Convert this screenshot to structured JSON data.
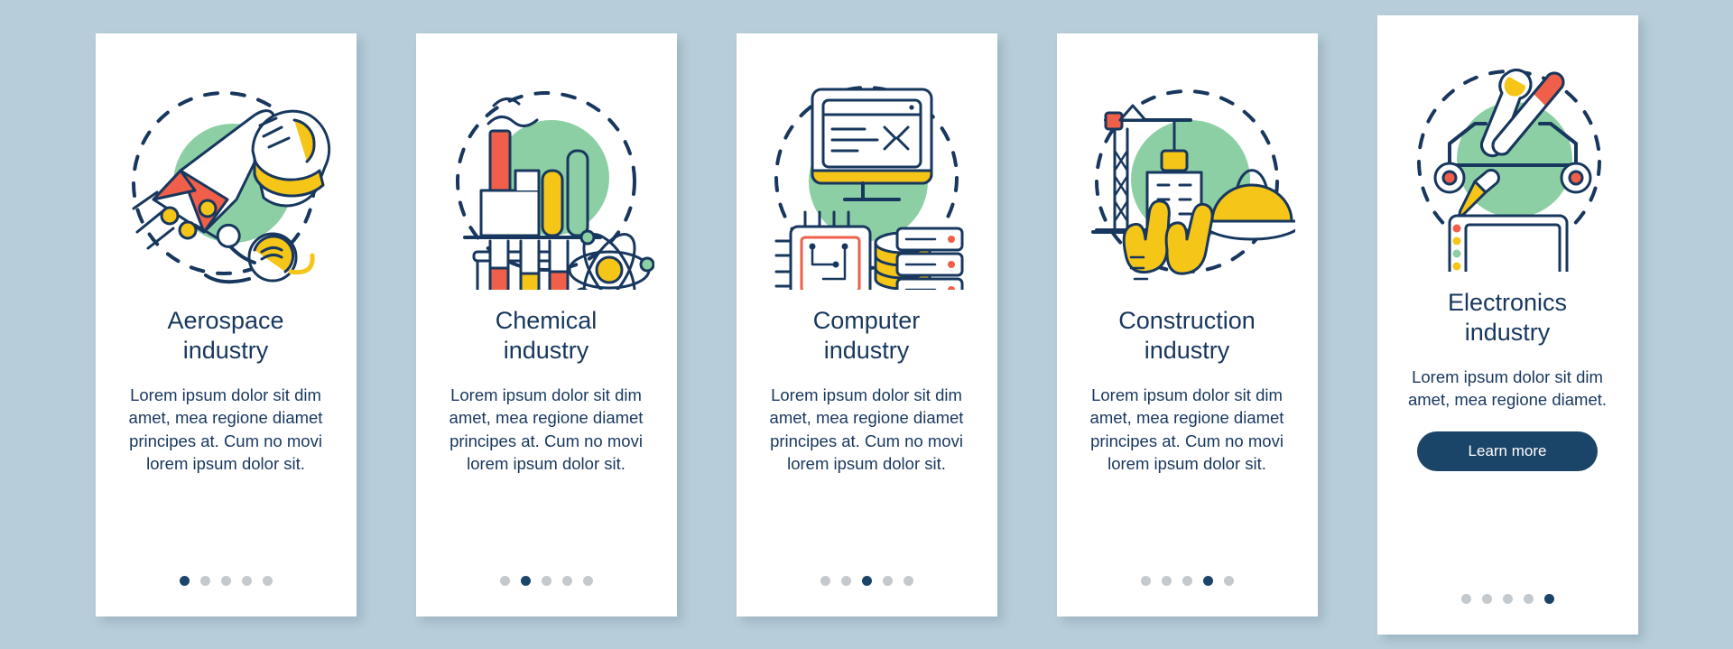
{
  "theme": {
    "background": "#b7cdd9",
    "card_background": "#ffffff",
    "ink": "#17375e",
    "accent_navy": "#1b4469",
    "accent_green": "#8ccfa4",
    "accent_yellow": "#f5c518",
    "accent_red": "#ef5f49",
    "dot_inactive": "#c3c9cd"
  },
  "cards": [
    {
      "icon": "aerospace-illustration",
      "title_line1": "Aerospace",
      "title_line2": "industry",
      "body": "Lorem ipsum dolor sit dim amet, mea regione diamet principes at. Cum no movi lorem ipsum dolor sit.",
      "dots": 5,
      "active_dot": 0,
      "has_button": false
    },
    {
      "icon": "chemical-illustration",
      "title_line1": "Chemical",
      "title_line2": "industry",
      "body": "Lorem ipsum dolor sit dim amet, mea regione diamet principes at. Cum no movi lorem ipsum dolor sit.",
      "dots": 5,
      "active_dot": 1,
      "has_button": false
    },
    {
      "icon": "computer-illustration",
      "title_line1": "Computer",
      "title_line2": "industry",
      "body": "Lorem ipsum dolor sit dim amet, mea regione diamet principes at. Cum no movi lorem ipsum dolor sit.",
      "dots": 5,
      "active_dot": 2,
      "has_button": false
    },
    {
      "icon": "construction-illustration",
      "title_line1": "Construction",
      "title_line2": "industry",
      "body": "Lorem ipsum dolor sit dim amet, mea regione diamet principes at. Cum no movi lorem ipsum dolor sit.",
      "dots": 5,
      "active_dot": 3,
      "has_button": false
    },
    {
      "icon": "electronics-illustration",
      "title_line1": "Electronics",
      "title_line2": "industry",
      "body": "Lorem ipsum dolor sit dim amet, mea regione diamet.",
      "button_label": "Learn more",
      "dots": 5,
      "active_dot": 4,
      "has_button": true
    }
  ]
}
